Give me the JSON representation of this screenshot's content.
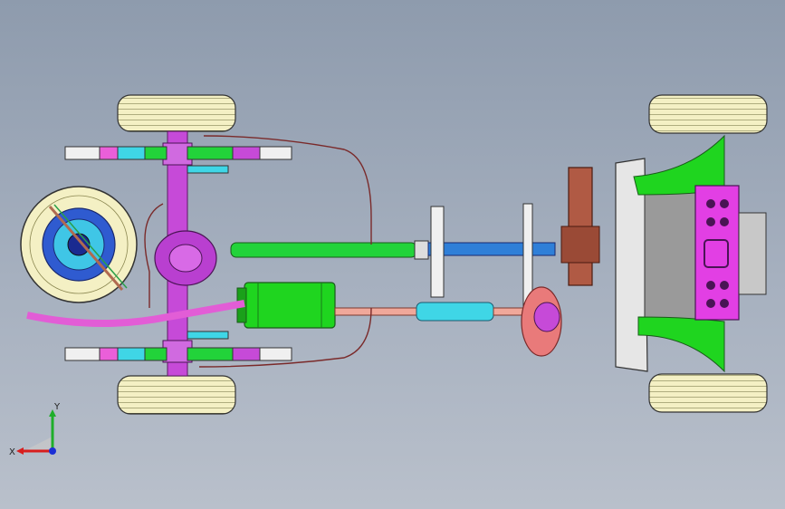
{
  "viewport": {
    "background_top": "#8e9bad",
    "background_bottom": "#b9c0cb"
  },
  "triad": {
    "x_label": "X",
    "y_label": "Y",
    "x_color": "#d81e1e",
    "y_color": "#1fae2a",
    "z_color": "#1b2fd6"
  },
  "model": {
    "tire_color": "#f4f0c4",
    "frame_green": "#1fd51f",
    "magenta": "#c64ad8",
    "cyan": "#3fd6e6",
    "blue": "#2f4cc8",
    "pink_exhaust": "#e25dd6",
    "engine_magenta": "#e23fe4",
    "brown": "#9a4a36",
    "steel": "#b8b8b8"
  }
}
